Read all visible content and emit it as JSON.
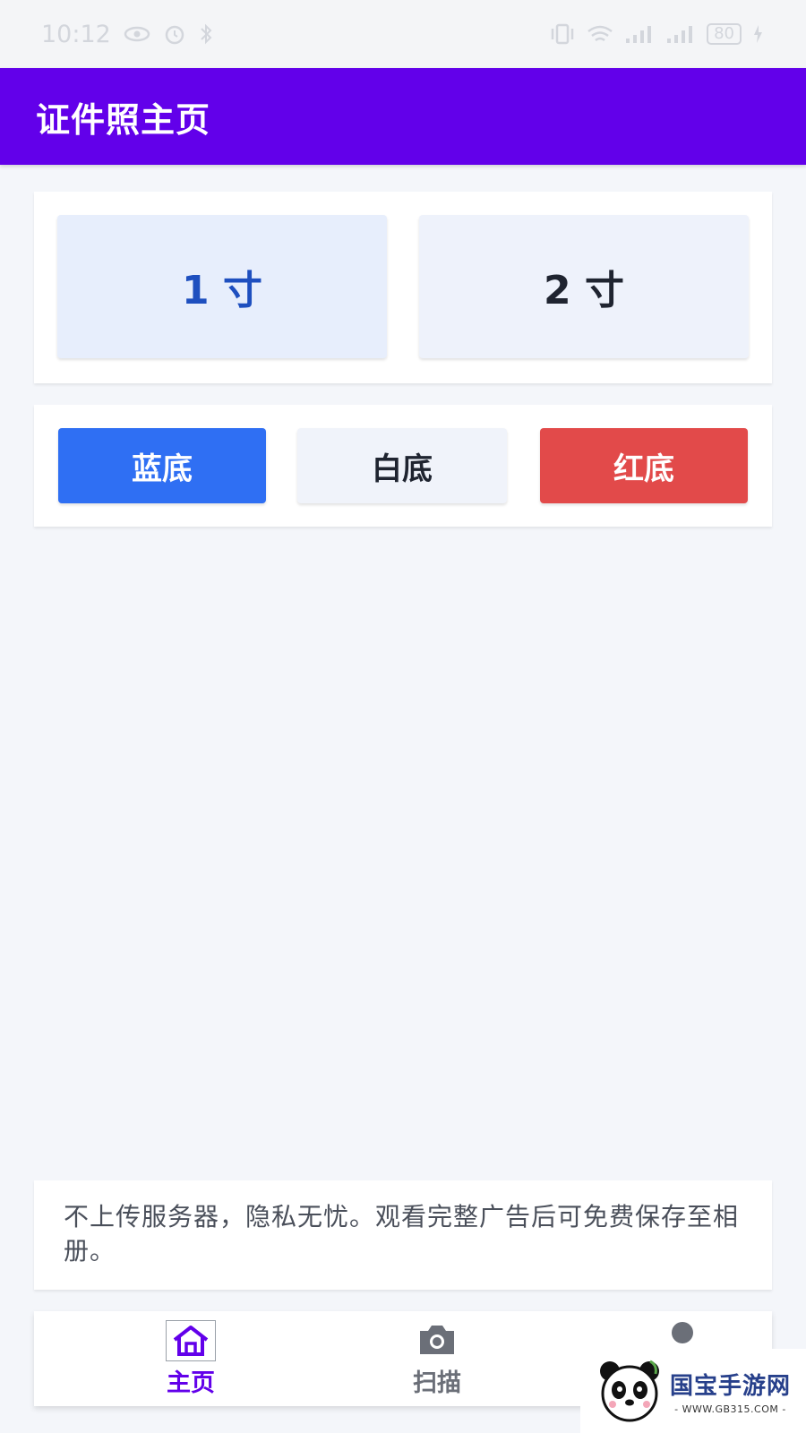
{
  "status_bar": {
    "time": "10:12",
    "battery": "80",
    "icons": [
      "eye-icon",
      "alarm-icon",
      "bluetooth-icon",
      "vibrate-icon",
      "wifi-icon",
      "signal-icon",
      "signal-icon",
      "charging-icon"
    ]
  },
  "app_bar": {
    "title": "证件照主页",
    "color": "#6200ea"
  },
  "sizes": [
    {
      "label": "1 寸",
      "selected": true
    },
    {
      "label": "2 寸",
      "selected": false
    }
  ],
  "backgrounds": [
    {
      "label": "蓝底",
      "color": "#2f6ff3"
    },
    {
      "label": "白底",
      "color": "#f0f3fa"
    },
    {
      "label": "红底",
      "color": "#e24a4a"
    }
  ],
  "notice": {
    "text": "不上传服务器，隐私无忧。观看完整广告后可免费保存至相册。"
  },
  "bottom_nav": [
    {
      "label": "主页",
      "icon": "home-icon",
      "active": true
    },
    {
      "label": "扫描",
      "icon": "camera-icon",
      "active": false
    },
    {
      "label": "",
      "icon": "person-icon",
      "active": false
    }
  ],
  "watermark": {
    "brand": "国宝手游网",
    "url": "- WWW.GB315.COM -"
  }
}
